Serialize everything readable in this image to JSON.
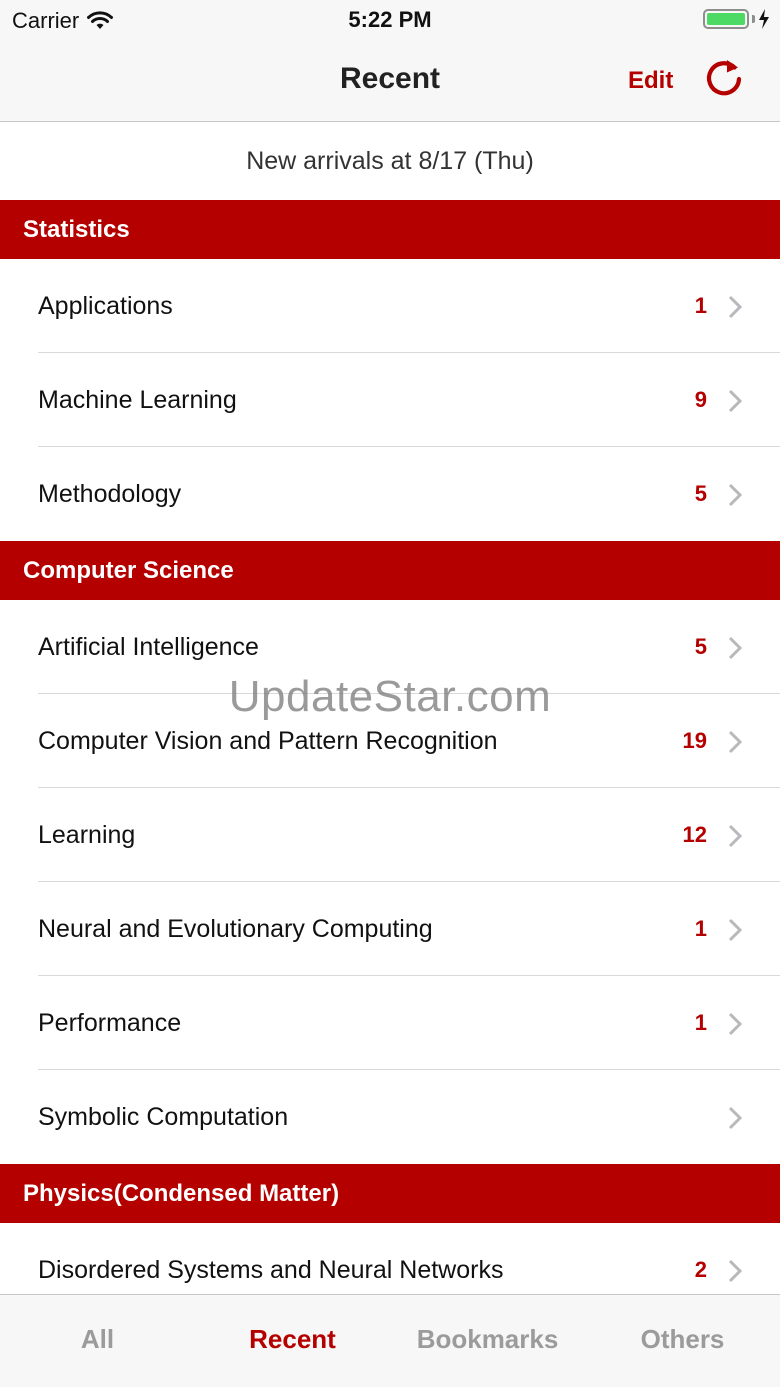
{
  "status_bar": {
    "carrier": "Carrier",
    "time": "5:22 PM"
  },
  "nav": {
    "title": "Recent",
    "edit_label": "Edit",
    "refresh_icon": "refresh-icon"
  },
  "banner": {
    "text": "New arrivals at 8/17 (Thu)"
  },
  "sections": [
    {
      "title": "Statistics",
      "rows": [
        {
          "label": "Applications",
          "count": "1"
        },
        {
          "label": "Machine Learning",
          "count": "9"
        },
        {
          "label": "Methodology",
          "count": "5"
        }
      ]
    },
    {
      "title": "Computer Science",
      "rows": [
        {
          "label": "Artificial Intelligence",
          "count": "5"
        },
        {
          "label": "Computer Vision and Pattern Recognition",
          "count": "19"
        },
        {
          "label": "Learning",
          "count": "12"
        },
        {
          "label": "Neural and Evolutionary Computing",
          "count": "1"
        },
        {
          "label": "Performance",
          "count": "1"
        },
        {
          "label": "Symbolic Computation",
          "count": ""
        }
      ]
    },
    {
      "title": "Physics(Condensed Matter)",
      "rows": [
        {
          "label": "Disordered Systems and Neural Networks",
          "count": "2"
        }
      ]
    }
  ],
  "watermark": "UpdateStar.com",
  "tabs": [
    {
      "label": "All",
      "active": false
    },
    {
      "label": "Recent",
      "active": true
    },
    {
      "label": "Bookmarks",
      "active": false
    },
    {
      "label": "Others",
      "active": false
    }
  ],
  "colors": {
    "accent": "#b50000",
    "battery": "#4cd964",
    "inactive_tab": "#9b9b9b"
  }
}
